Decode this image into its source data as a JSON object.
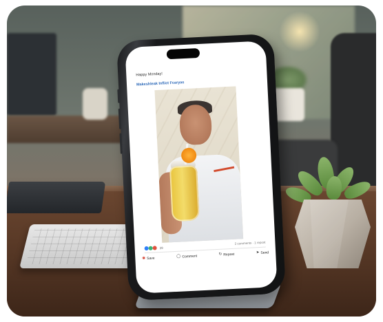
{
  "post": {
    "header_text": "Happy Monday!",
    "title_text": "Makeshleak Inflict Fcaryas",
    "reactions_count": "29",
    "meta_text": "2 comments · 1 repost"
  },
  "actions": {
    "save_label": "Save",
    "comment_label": "Comment",
    "repost_label": "Repost",
    "send_label": "Send"
  },
  "icons": {
    "save": "bookmark-icon",
    "comment": "comment-icon",
    "repost": "repost-icon",
    "send": "send-icon"
  },
  "colors": {
    "title_link": "#2b68b8",
    "save_accent": "#d23a2a",
    "reaction_blue": "#2d7ff9",
    "reaction_green": "#3bb273",
    "reaction_red": "#e0513f"
  }
}
